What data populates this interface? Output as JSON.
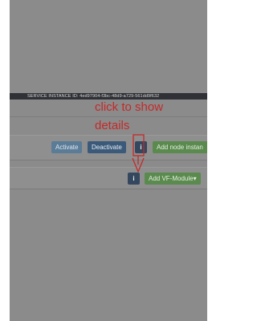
{
  "service_instance": {
    "id_line": "SERVICE INSTANCE ID: 4ed97904-f3bc-48d9-a729-561dd9f632"
  },
  "annotation": {
    "line1": "click to show",
    "line2": "details",
    "color": "#c62828"
  },
  "node_row": {
    "activate_label": "Activate",
    "deactivate_label": "Deactivate",
    "info_glyph": "i",
    "add_node_label": "Add node instan"
  },
  "vf_row": {
    "info_glyph": "i",
    "add_vf_label": "Add VF-Module▾"
  },
  "icons": {
    "info": "info-icon",
    "arrow": "arrow-down-icon",
    "dropdown": "caret-down-icon"
  }
}
